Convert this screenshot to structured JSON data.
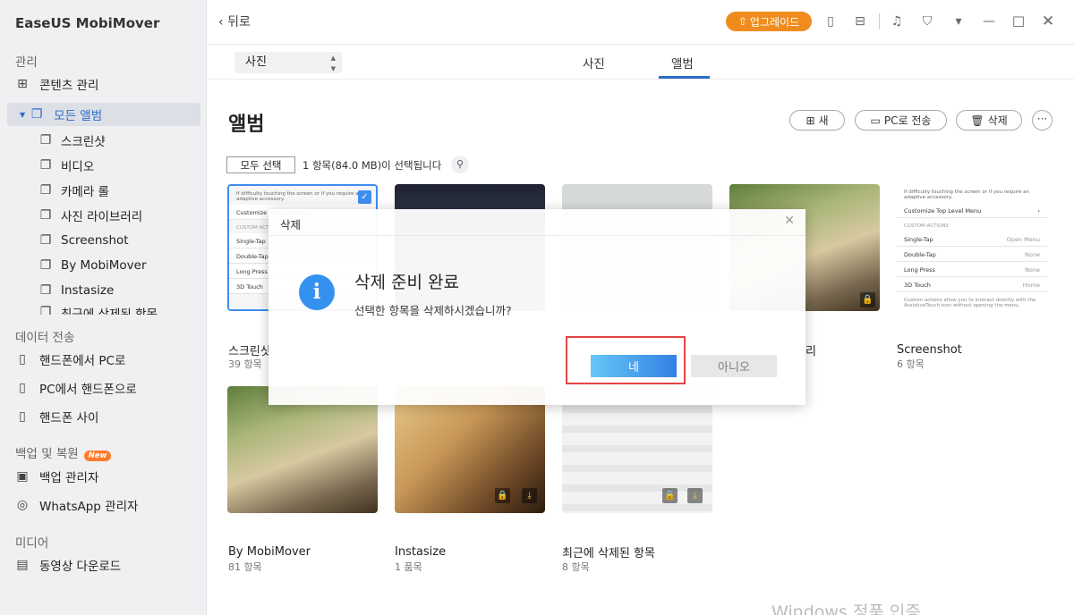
{
  "app": {
    "name": "EaseUS MobiMover"
  },
  "sidebar": {
    "sec_manage": "관리",
    "content_manage": "콘텐츠 관리",
    "all_albums": "모든 앨범",
    "sub": [
      "스크린샷",
      "비디오",
      "카메라 롤",
      "사진 라이브러리",
      "Screenshot",
      "By MobiMover",
      "Instasize",
      "최근에 삭제된 항목"
    ],
    "sec_transfer": "데이터 전송",
    "phone_to_pc": "핸드폰에서 PC로",
    "pc_to_phone": "PC에서 핸드폰으로",
    "phone_to_phone": "핸드폰 사이",
    "sec_backup": "백업 및 복원",
    "new_badge": "New",
    "backup_manager": "백업 관리자",
    "whatsapp_manager": "WhatsApp 관리자",
    "sec_media": "미디어",
    "video_downloader": "동영상 다운로드"
  },
  "topbar": {
    "back": "뒤로",
    "upgrade": "업그레이드"
  },
  "toolbar": {
    "select_value": "사진",
    "tab_photos": "사진",
    "tab_albums": "앨범"
  },
  "page": {
    "title": "앨범",
    "new_btn": "새",
    "to_pc_btn": "PC로 전송",
    "delete_btn": "삭제",
    "select_all": "모두 선택",
    "selection_info": "1 항목(84.0 MB)이 선택됩니다"
  },
  "albums": [
    {
      "name": "스크린샷",
      "count": "39 항목"
    },
    {
      "name": "",
      "count": ""
    },
    {
      "name": "",
      "count": ""
    },
    {
      "name": "사진 라이브러리",
      "count": ""
    },
    {
      "name": "Screenshot",
      "count": "6 항목"
    },
    {
      "name": "By MobiMover",
      "count": "81 항목"
    },
    {
      "name": "Instasize",
      "count": "1 품목"
    },
    {
      "name": "최근에 삭제된 항목",
      "count": "8 항목"
    }
  ],
  "ios_settings": {
    "top_text": "If difficulty touching the screen or if you require an adaptive accessory.",
    "customize": "Customize Top Level Menu",
    "custom_actions": "CUSTOM ACTIONS",
    "single_tap": "Single-Tap",
    "single_val": "Open Menu",
    "double_tap": "Double-Tap",
    "double_val": "None",
    "long_press": "Long Press",
    "long_val": "None",
    "touch_3d": "3D Touch",
    "touch_val": "Home",
    "footer": "Custom actions allow you to interact directly with the AssistiveTouch icon without opening the menu."
  },
  "dialog": {
    "title": "삭제",
    "heading": "삭제 준비 완료",
    "message": "선택한 항목을 삭제하시겠습니까?",
    "yes": "네",
    "no": "아니오"
  },
  "watermark": "Windows 정품 인증",
  "colors": {
    "accent": "#2a6cc9",
    "upgrade": "#f08c1e",
    "highlight": "#e53b3b"
  }
}
